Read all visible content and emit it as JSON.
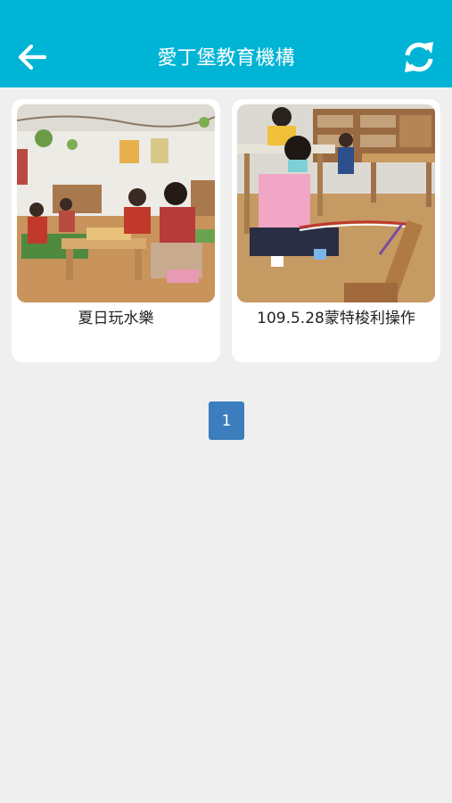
{
  "header": {
    "title": "愛丁堡教育機構",
    "background": "#00b4d6",
    "back_icon": "arrow-left-icon",
    "refresh_icon": "refresh-icon"
  },
  "albums": [
    {
      "caption": "夏日玩水樂"
    },
    {
      "caption": "109.5.28蒙特梭利操作"
    }
  ],
  "pagination": {
    "current": "1",
    "color": "#3b7dbd"
  }
}
